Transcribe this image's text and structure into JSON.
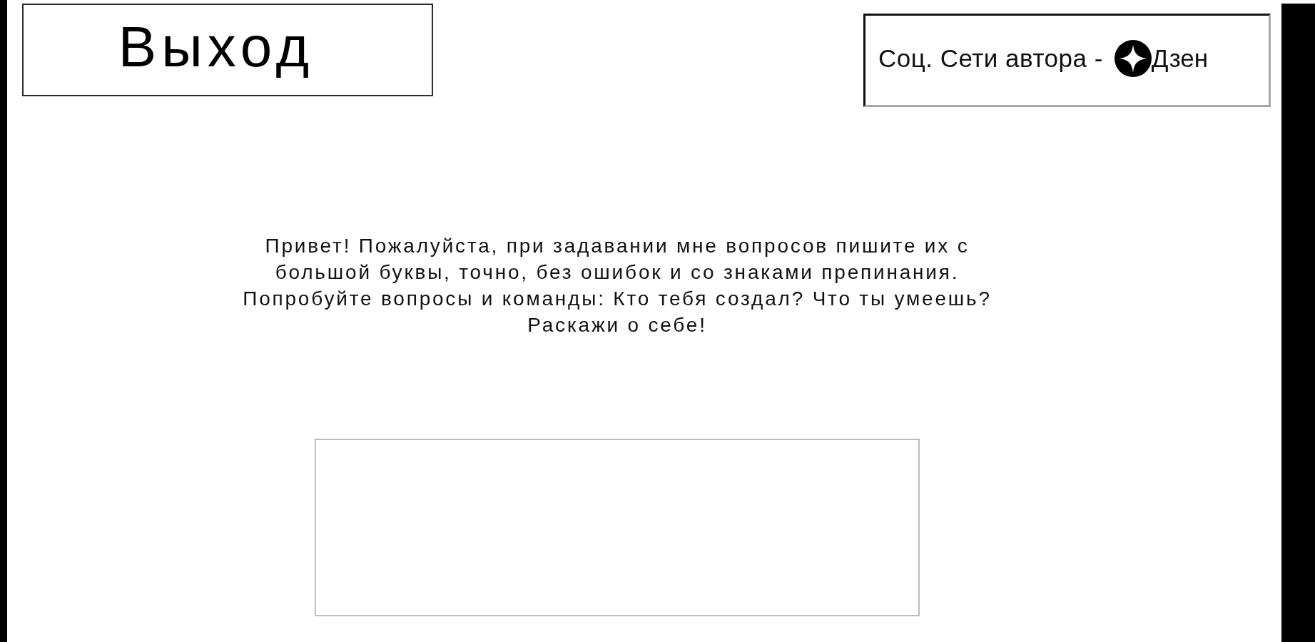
{
  "exit_button": {
    "label": "Выход"
  },
  "author_socials": {
    "label": "Соц. Сети автора -",
    "links": [
      {
        "label": "Дзен"
      }
    ]
  },
  "intro_text": "Привет! Пожалуйста, при задавании мне вопросов пишите их с\nбольшой буквы, точно, без ошибок и со знаками препинания.\nПопробуйте вопросы и команды: Кто тебя создал? Что ты умеешь?\nРаскажи о себе!"
}
